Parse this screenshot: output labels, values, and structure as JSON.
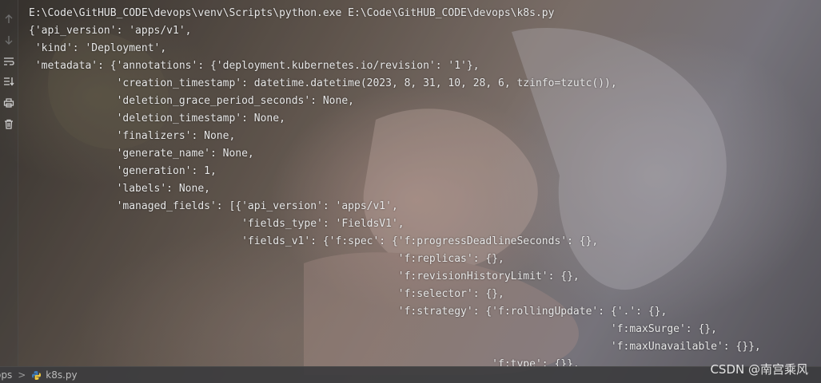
{
  "console": {
    "lines": [
      "E:\\Code\\GitHUB_CODE\\devops\\venv\\Scripts\\python.exe E:\\Code\\GitHUB_CODE\\devops\\k8s.py",
      "{'api_version': 'apps/v1',",
      " 'kind': 'Deployment',",
      " 'metadata': {'annotations': {'deployment.kubernetes.io/revision': '1'},",
      "              'creation_timestamp': datetime.datetime(2023, 8, 31, 10, 28, 6, tzinfo=tzutc()),",
      "              'deletion_grace_period_seconds': None,",
      "              'deletion_timestamp': None,",
      "              'finalizers': None,",
      "              'generate_name': None,",
      "              'generation': 1,",
      "              'labels': None,",
      "              'managed_fields': [{'api_version': 'apps/v1',",
      "                                  'fields_type': 'FieldsV1',",
      "                                  'fields_v1': {'f:spec': {'f:progressDeadlineSeconds': {},",
      "                                                           'f:replicas': {},",
      "                                                           'f:revisionHistoryLimit': {},",
      "                                                           'f:selector': {},",
      "                                                           'f:strategy': {'f:rollingUpdate': {'.': {},",
      "                                                                                             'f:maxSurge': {},",
      "                                                                                             'f:maxUnavailable': {}},",
      "                                                                          'f:type': {}},"
    ]
  },
  "statusbar": {
    "project": "ops",
    "separator": ">",
    "file": "k8s.py"
  },
  "watermark": "CSDN @南宫乘风",
  "gutter_icons": [
    "arrow-up-icon",
    "arrow-down-icon",
    "soft-wrap-icon",
    "scroll-to-end-icon",
    "print-icon",
    "trash-icon"
  ]
}
